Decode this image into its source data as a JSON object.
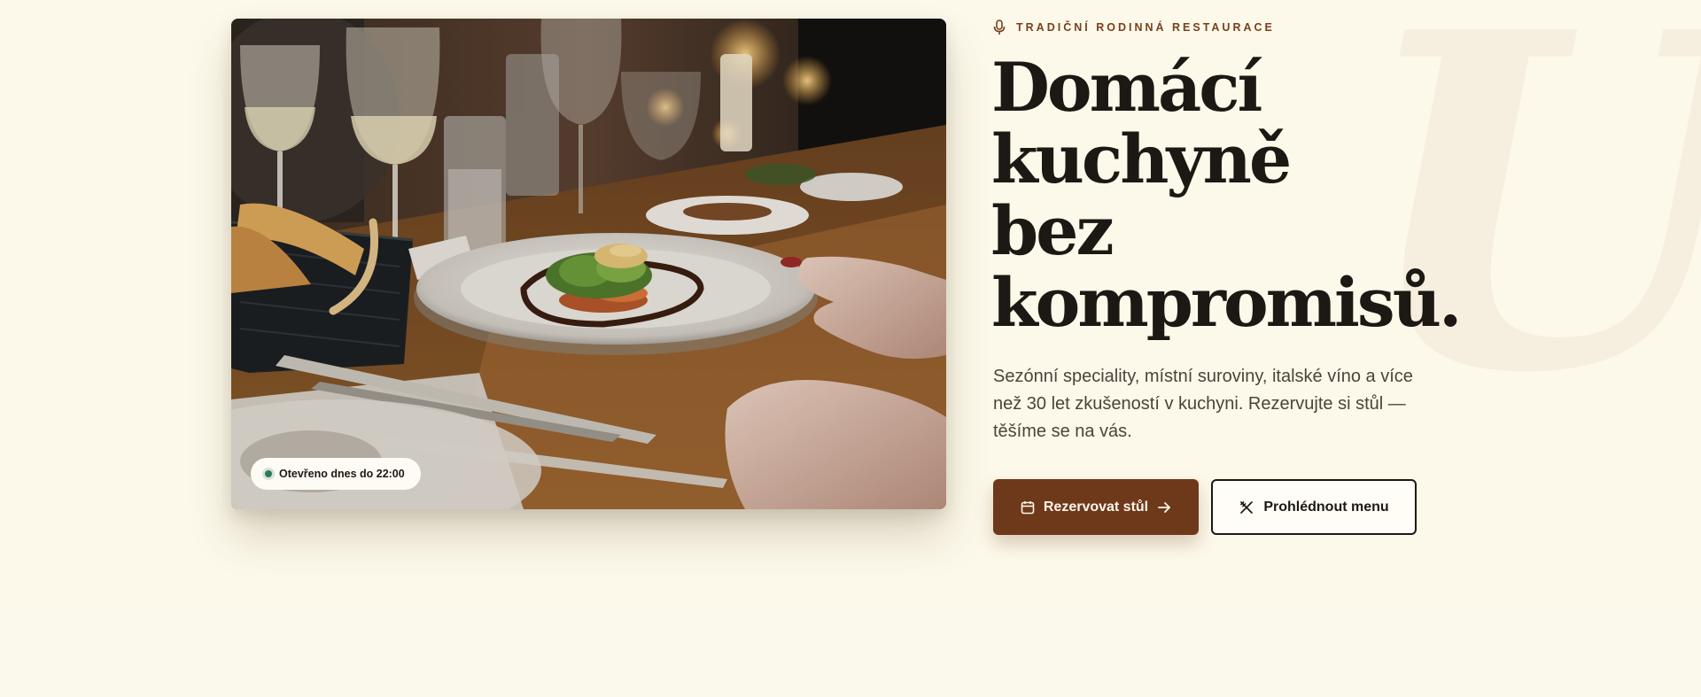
{
  "hero": {
    "watermark": "U",
    "eyebrow": {
      "icon": "microphone-icon",
      "text": "TRADIČNÍ RODINNÁ RESTAURACE"
    },
    "headline_lines": [
      "Domácí",
      "kuchyně",
      "bez",
      "kompromisů."
    ],
    "lead": "Sezónní speciality, místní suroviny, italské víno a více než 30 let zkušeností v kuchyni. Rezervujte si stůl — těšíme se na vás.",
    "photo": {
      "badge": "Otevřeno dnes do 22:00",
      "badge_status_color": "#2f7a55"
    },
    "buttons": {
      "primary": {
        "label": "Rezervovat stůl",
        "icon": "calendar-icon",
        "trailing_icon": "arrow-right-icon"
      },
      "secondary": {
        "label": "Prohlédnout menu",
        "icon": "utensils-crossed-icon"
      }
    }
  },
  "colors": {
    "background": "#fdf9ea",
    "accent": "#6e381b",
    "eyebrow": "#7a3f1c",
    "text": "#1c1914"
  }
}
